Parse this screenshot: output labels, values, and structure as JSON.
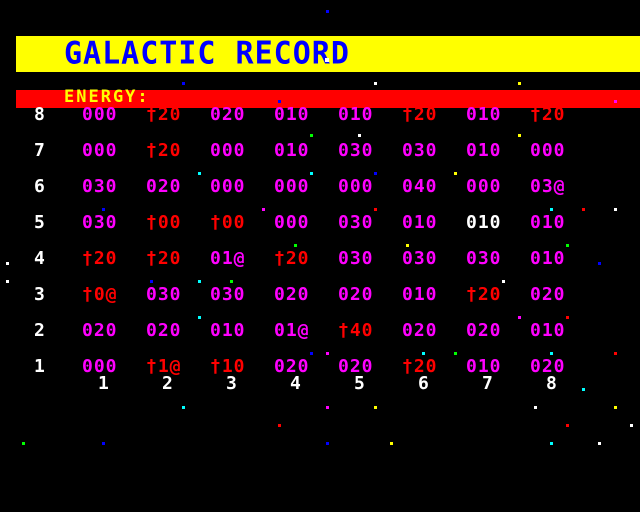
{
  "title": "GALACTIC RECORD",
  "energy_label": "ENERGY:",
  "colors": {
    "background": "#000000",
    "title_bar": "#ffff00",
    "title_text": "#0000ff",
    "energy_bar": "#ff0000",
    "energy_text": "#ffff00",
    "magenta": "#ff00ff",
    "red": "#ff0000",
    "white": "#ffffff"
  },
  "row_labels": [
    "8",
    "7",
    "6",
    "5",
    "4",
    "3",
    "2",
    "1"
  ],
  "col_labels": [
    "1",
    "2",
    "3",
    "4",
    "5",
    "6",
    "7",
    "8"
  ],
  "grid": [
    [
      [
        "000",
        "m"
      ],
      [
        "†20",
        "r"
      ],
      [
        "020",
        "m"
      ],
      [
        "010",
        "m"
      ],
      [
        "010",
        "m"
      ],
      [
        "†20",
        "r"
      ],
      [
        "010",
        "m"
      ],
      [
        "†20",
        "r"
      ]
    ],
    [
      [
        "000",
        "m"
      ],
      [
        "†20",
        "r"
      ],
      [
        "000",
        "m"
      ],
      [
        "010",
        "m"
      ],
      [
        "030",
        "m"
      ],
      [
        "030",
        "m"
      ],
      [
        "010",
        "m"
      ],
      [
        "000",
        "m"
      ]
    ],
    [
      [
        "030",
        "m"
      ],
      [
        "020",
        "m"
      ],
      [
        "000",
        "m"
      ],
      [
        "000",
        "m"
      ],
      [
        "000",
        "m"
      ],
      [
        "040",
        "m"
      ],
      [
        "000",
        "m"
      ],
      [
        "03@",
        "m"
      ]
    ],
    [
      [
        "030",
        "m"
      ],
      [
        "†00",
        "r"
      ],
      [
        "†00",
        "r"
      ],
      [
        "000",
        "m"
      ],
      [
        "030",
        "m"
      ],
      [
        "010",
        "m"
      ],
      [
        "010",
        "w"
      ],
      [
        "010",
        "m"
      ]
    ],
    [
      [
        "†20",
        "r"
      ],
      [
        "†20",
        "r"
      ],
      [
        "01@",
        "m"
      ],
      [
        "†20",
        "r"
      ],
      [
        "030",
        "m"
      ],
      [
        "030",
        "m"
      ],
      [
        "030",
        "m"
      ],
      [
        "010",
        "m"
      ]
    ],
    [
      [
        "†0@",
        "r"
      ],
      [
        "030",
        "m"
      ],
      [
        "030",
        "m"
      ],
      [
        "020",
        "m"
      ],
      [
        "020",
        "m"
      ],
      [
        "010",
        "m"
      ],
      [
        "†20",
        "r"
      ],
      [
        "020",
        "m"
      ]
    ],
    [
      [
        "020",
        "m"
      ],
      [
        "020",
        "m"
      ],
      [
        "010",
        "m"
      ],
      [
        "01@",
        "m"
      ],
      [
        "†40",
        "r"
      ],
      [
        "020",
        "m"
      ],
      [
        "020",
        "m"
      ],
      [
        "010",
        "m"
      ]
    ],
    [
      [
        "000",
        "m"
      ],
      [
        "†1@",
        "r"
      ],
      [
        "†10",
        "r"
      ],
      [
        "020",
        "m"
      ],
      [
        "020",
        "m"
      ],
      [
        "†20",
        "r"
      ],
      [
        "010",
        "m"
      ],
      [
        "020",
        "m"
      ]
    ]
  ]
}
